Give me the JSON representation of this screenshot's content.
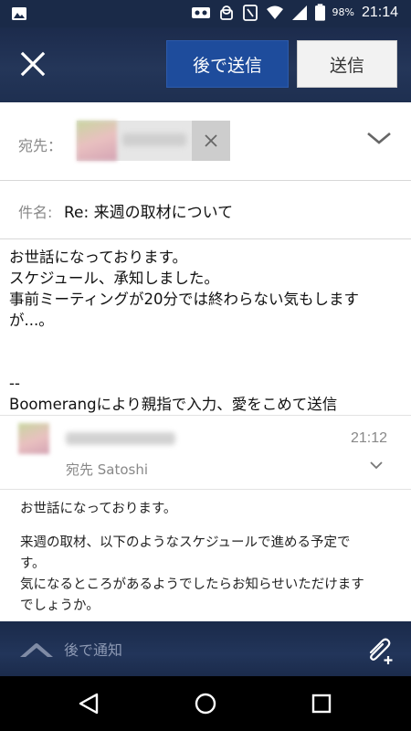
{
  "status_bar": {
    "battery": "98%",
    "time": "21:14",
    "icons": [
      "image-icon",
      "voicemail-icon",
      "android-icon",
      "nfc-icon",
      "wifi-icon",
      "signal-icon",
      "battery-icon"
    ]
  },
  "app_bar": {
    "close_icon": "close-icon",
    "send_later_label": "後で送信",
    "send_label": "送信",
    "accent": "#1e4c9c"
  },
  "to": {
    "label": "宛先："
  },
  "subject": {
    "label": "件名:",
    "value": "Re: 来週の取材について"
  },
  "body": {
    "lines": [
      "お世話になっております。",
      "スケジュール、承知しました。",
      "事前ミーティングが20分では終わらない気もします",
      "が...。"
    ],
    "signature_dash": "--",
    "signature": "Boomerangにより親指で入力、愛をこめて送信"
  },
  "quoted": {
    "recipient": "宛先 Satoshi",
    "time": "21:12",
    "paragraphs": [
      [
        "お世話になっております。"
      ],
      [
        "来週の取材、以下のようなスケジュールで進める予定で",
        "す。",
        "気になるところがあるようでしたらお知らせいただけます",
        "でしょうか。"
      ]
    ]
  },
  "toolbar": {
    "notify_label": "後で通知",
    "notify_icon": "boomerang-icon",
    "attach_icon": "attach-add-icon"
  },
  "nav_bar": {
    "icons": [
      "back-icon",
      "home-icon",
      "recents-icon"
    ]
  }
}
